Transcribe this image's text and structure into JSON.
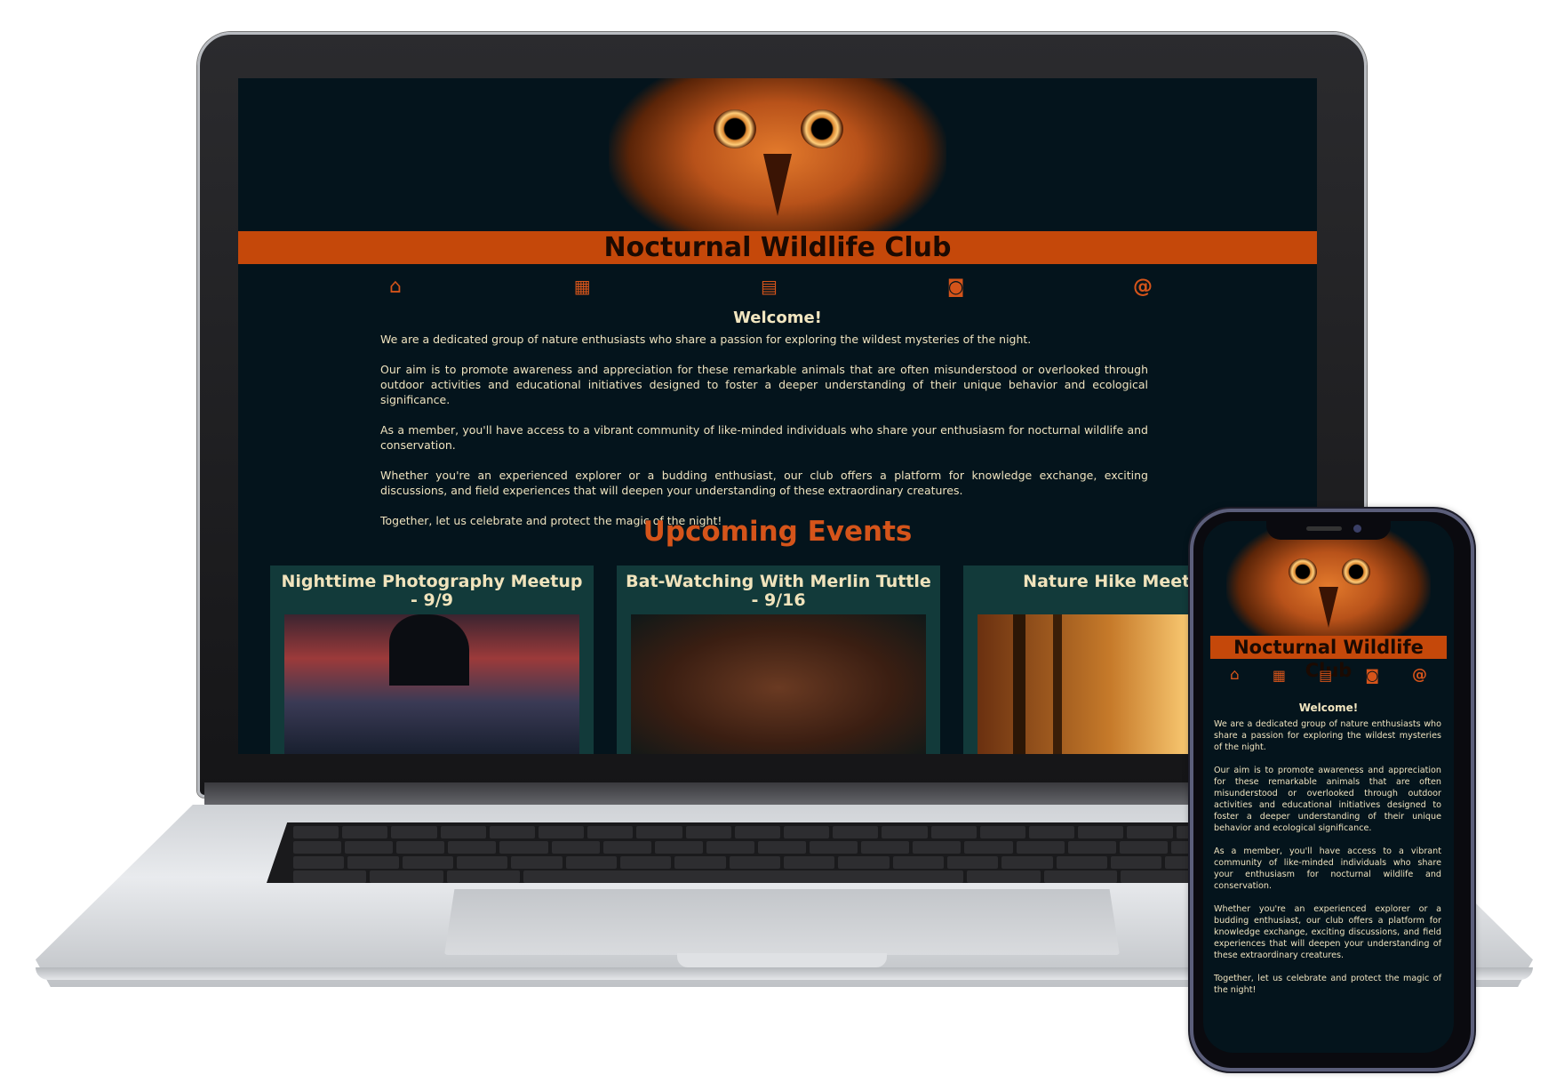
{
  "site": {
    "title": "Nocturnal Wildlife Club",
    "nav": [
      {
        "name": "home-icon",
        "glyph": "⌂"
      },
      {
        "name": "calendar-icon",
        "glyph": "▦"
      },
      {
        "name": "table-icon",
        "glyph": "▤"
      },
      {
        "name": "camera-icon",
        "glyph": "◙"
      },
      {
        "name": "at-icon",
        "glyph": "@"
      }
    ],
    "welcome_title": "Welcome!",
    "paragraphs": [
      "We are a dedicated group of nature enthusiasts who share a passion for exploring the wildest mysteries of the night.",
      "Our aim is to promote awareness and appreciation for these remarkable animals that are often misunderstood or overlooked through outdoor activities and educational initiatives designed to foster a deeper understanding of their unique behavior and ecological significance.",
      "As a member, you'll have access to a vibrant community of like-minded individuals who share your enthusiasm for nocturnal wildlife and conservation.",
      "Whether you're an experienced explorer or a budding enthusiast, our club offers a platform for knowledge exchange, exciting discussions, and field experiences that will deepen your understanding of these extraordinary creatures.",
      "Together, let us celebrate and protect the magic of the night!"
    ],
    "events_title": "Upcoming Events",
    "events": [
      {
        "title": "Nighttime Photography Meetup - 9/9"
      },
      {
        "title": "Bat-Watching With Merlin Tuttle - 9/16"
      },
      {
        "title": "Nature Hike Meetup -"
      }
    ]
  },
  "colors": {
    "accent": "#d5541a",
    "banner": "#c5480a",
    "background": "#04141c",
    "card": "#123a3a",
    "text": "#efe3bf"
  }
}
